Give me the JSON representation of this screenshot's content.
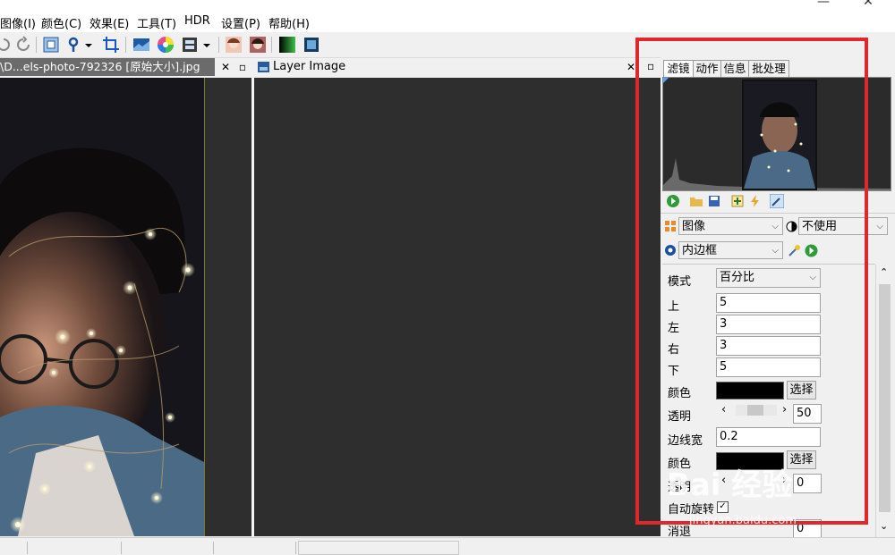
{
  "menu": [
    "图像(I)",
    "颜色(C)",
    "效果(E)",
    "工具(T)",
    "HDR",
    "设置(P)",
    "帮助(H)"
  ],
  "window_buttons": [
    "—",
    "✕"
  ],
  "doc_tabs": {
    "doc1": {
      "title": "\\D...els-photo-792326 [原始大小].jpg",
      "close": "✕",
      "pin": "▫"
    },
    "doc2": {
      "title": "Layer Image",
      "close": "✕",
      "pin": "▫"
    }
  },
  "panel": {
    "pin": "▫",
    "tabs": [
      "滤镜",
      "动作",
      "信息",
      "批处理"
    ],
    "target_combo": "图像",
    "mask_combo": "不使用",
    "filter_combo": "内边框",
    "fields": {
      "mode_label": "模式",
      "mode_value": "百分比",
      "top_label": "上",
      "top_value": "5",
      "left_label": "左",
      "left_value": "3",
      "right_label": "右",
      "right_value": "3",
      "bottom_label": "下",
      "bottom_value": "5",
      "color_label": "颜色",
      "choose": "选择",
      "alpha_label": "透明",
      "alpha_value": "50",
      "border_width_label": "边线宽",
      "border_width_value": "0.2",
      "color2_label": "颜色",
      "choose2": "选择",
      "alpha2_label": "透明",
      "alpha2_value": "0",
      "autorotate_label": "自动旋转",
      "blur_label": "消退",
      "blur_value": "0"
    }
  },
  "watermark": {
    "brand": "Bai 经验",
    "url": "jingyan.baidu.com"
  },
  "colors": {
    "highlight": "#e0272b",
    "panel_bg": "#f0f0f0",
    "canvas_bg": "#2e2e2e",
    "active_tab": "#6b6b6b"
  }
}
